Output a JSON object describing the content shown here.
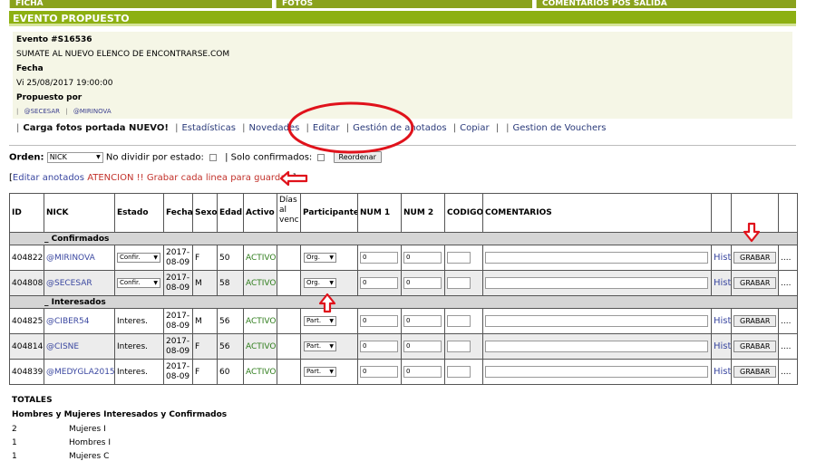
{
  "top_tabs": [
    "FICHA",
    "FOTOS",
    "COMENTARIOS POS SALIDA"
  ],
  "header": {
    "title": "EVENTO PROPUESTO"
  },
  "event": {
    "id_label": "Evento #S16536",
    "name": "SUMATE AL NUEVO ELENCO DE ENCONTRARSE.COM",
    "fecha_label": "Fecha",
    "fecha_value": "Vi 25/08/2017 19:00:00",
    "propuesto_label": "Propuesto por",
    "proponents": [
      "@SECESAR",
      "@MIRINOVA"
    ]
  },
  "nav": {
    "items": [
      "Carga fotos portada NUEVO!",
      "Estadísticas",
      "Novedades",
      "Editar",
      "Gestión de anotados",
      "Copiar",
      "",
      "Gestion de Vouchers"
    ]
  },
  "order": {
    "label": "Orden:",
    "value": "NICK",
    "no_dividir": "No dividir por estado:",
    "solo_confirmados": "Solo confirmados:",
    "reordenar": "Reordenar"
  },
  "edit_notice": {
    "open": "[",
    "link": "Editar anotados",
    "warning": "ATENCION !! Grabar cada linea para guardar",
    "close": "]"
  },
  "table": {
    "headers": {
      "id": "ID",
      "nick": "NICK",
      "estado": "Estado",
      "fecha": "Fecha",
      "sexo": "Sexo",
      "edad": "Edad",
      "activo": "Activo",
      "dias": "Días al venc",
      "participante": "Participante",
      "num1": "NUM 1",
      "num2": "NUM 2",
      "codigo": "CODIGO",
      "comentarios": "COMENTARIOS"
    },
    "group_confirmados": "_ Confirmados",
    "group_interesados": "_ Interesados",
    "rows_confirmados": [
      {
        "id": "404822",
        "nick": "@MIRINOVA",
        "estado": "Confir.",
        "fecha1": "2017-",
        "fecha2": "08-09",
        "sexo": "F",
        "edad": "50",
        "activo": "ACTIVO",
        "participante": "Org.",
        "num1": "0",
        "num2": "0",
        "hist": "Hist",
        "grabar": "GRABAR",
        "more": "...."
      },
      {
        "id": "404808",
        "nick": "@SECESAR",
        "estado": "Confir.",
        "fecha1": "2017-",
        "fecha2": "08-09",
        "sexo": "M",
        "edad": "58",
        "activo": "ACTIVO",
        "participante": "Org.",
        "num1": "0",
        "num2": "0",
        "hist": "Hist",
        "grabar": "GRABAR",
        "more": "...."
      }
    ],
    "rows_interesados": [
      {
        "id": "404825",
        "nick": "@CIBER54",
        "estado": "Interes.",
        "fecha1": "2017-",
        "fecha2": "08-09",
        "sexo": "M",
        "edad": "56",
        "activo": "ACTIVO",
        "participante": "Part.",
        "num1": "0",
        "num2": "0",
        "hist": "Hist",
        "grabar": "GRABAR",
        "more": "...."
      },
      {
        "id": "404814",
        "nick": "@CISNE",
        "estado": "Interes.",
        "fecha1": "2017-",
        "fecha2": "08-09",
        "sexo": "F",
        "edad": "56",
        "activo": "ACTIVO",
        "participante": "Part.",
        "num1": "0",
        "num2": "0",
        "hist": "Hist",
        "grabar": "GRABAR",
        "more": "...."
      },
      {
        "id": "404839",
        "nick": "@MEDYGLA2015",
        "estado": "Interes.",
        "fecha1": "2017-",
        "fecha2": "08-09",
        "sexo": "F",
        "edad": "60",
        "activo": "ACTIVO",
        "participante": "Part.",
        "num1": "0",
        "num2": "0",
        "hist": "Hist",
        "grabar": "GRABAR",
        "more": "...."
      }
    ]
  },
  "totales": {
    "title": "TOTALES",
    "subtitle": "Hombres y Mujeres Interesados y Confirmados",
    "lines": [
      {
        "n": "2",
        "label": "Mujeres I"
      },
      {
        "n": "1",
        "label": "Hombres I"
      },
      {
        "n": "1",
        "label": "Mujeres C"
      }
    ]
  },
  "colors": {
    "header_green": "#8db012",
    "annotation_red": "#e0121b",
    "link_blue": "#3a47a0"
  }
}
